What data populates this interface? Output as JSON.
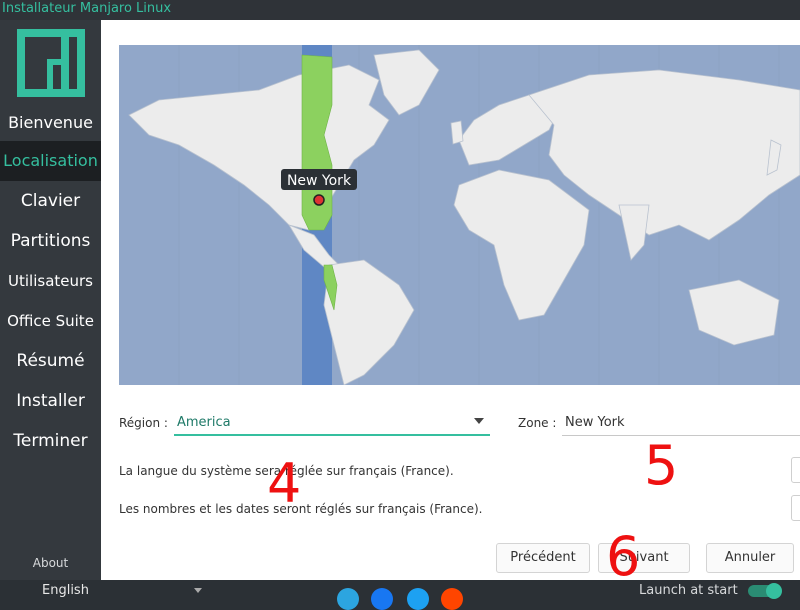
{
  "window": {
    "title": "Installateur Manjaro Linux"
  },
  "sidebar": {
    "items": [
      {
        "label": "Bienvenue"
      },
      {
        "label": "Localisation"
      },
      {
        "label": "Clavier"
      },
      {
        "label": "Partitions"
      },
      {
        "label": "Utilisateurs"
      },
      {
        "label": "Office Suite"
      },
      {
        "label": "Résumé"
      },
      {
        "label": "Installer"
      },
      {
        "label": "Terminer"
      }
    ],
    "active_item": "Localisation",
    "about_label": "About"
  },
  "map": {
    "marker_label": "New York"
  },
  "region": {
    "label": "Région :",
    "value": "America"
  },
  "zone": {
    "label": "Zone :",
    "value": "New York"
  },
  "info": {
    "language_text": "La langue du système sera réglée sur français (France).",
    "numbers_text": "Les nombres et les dates seront réglés sur français (France)."
  },
  "buttons": {
    "previous": "Précédent",
    "next": "Suivant",
    "cancel": "Annuler"
  },
  "annotations": [
    "4",
    "5",
    "6"
  ],
  "bottombar": {
    "language": "English",
    "launch_label": "Launch at start",
    "launch_at_start": true,
    "social_icons": [
      "telegram-icon",
      "facebook-icon",
      "twitter-icon",
      "reddit-icon"
    ]
  },
  "colors": {
    "accent": "#35bf9f",
    "sidebar_bg": "#34393e",
    "active_bg": "#1c1f22",
    "ocean": "#91a7c9",
    "land": "#ececec",
    "timezone_band": "#5f87c4",
    "timezone_land": "#8cd15f",
    "annotation": "#ee1111"
  }
}
